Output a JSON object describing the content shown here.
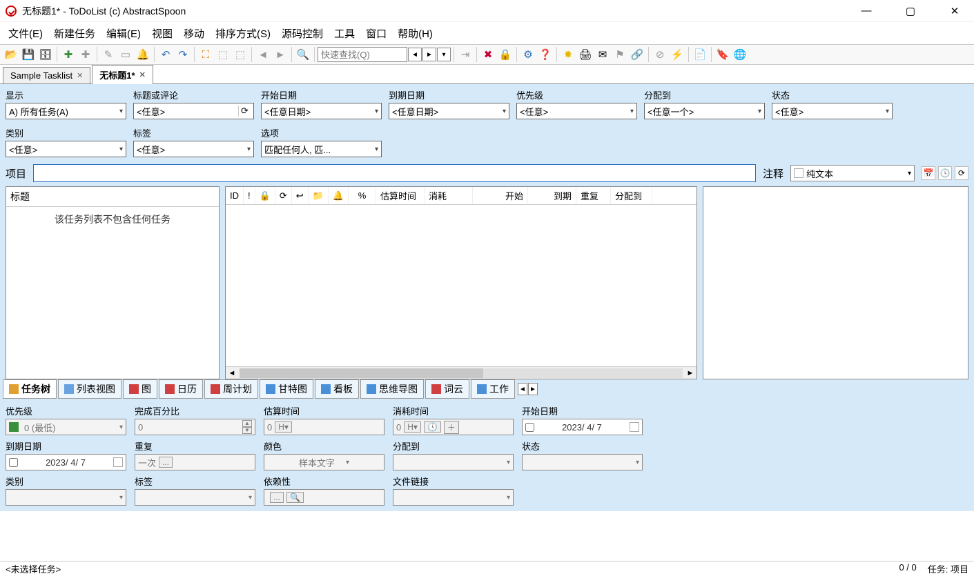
{
  "title": "无标题1* - ToDoList (c) AbstractSpoon",
  "menu": [
    "文件(E)",
    "新建任务",
    "编辑(E)",
    "视图",
    "移动",
    "排序方式(S)",
    "源码控制",
    "工具",
    "窗口",
    "帮助(H)"
  ],
  "search_placeholder": "快速查找(Q)",
  "tabs": [
    {
      "label": "Sample Tasklist",
      "active": false
    },
    {
      "label": "无标题1*",
      "active": true
    }
  ],
  "filters": {
    "display": {
      "label": "显示",
      "value": "A) 所有任务(A)"
    },
    "title": {
      "label": "标题或评论",
      "value": "<任意>"
    },
    "start": {
      "label": "开始日期",
      "value": "<任意日期>"
    },
    "due": {
      "label": "到期日期",
      "value": "<任意日期>"
    },
    "prio": {
      "label": "优先级",
      "value": "<任意>"
    },
    "assign": {
      "label": "分配到",
      "value": "<任意一个>"
    },
    "status": {
      "label": "状态",
      "value": "<任意>"
    },
    "category": {
      "label": "类别",
      "value": "<任意>"
    },
    "tag": {
      "label": "标签",
      "value": "<任意>"
    },
    "option": {
      "label": "选项",
      "value": "匹配任何人, 匹..."
    }
  },
  "project_label": "项目",
  "comment_label": "注释",
  "comment_type": "纯文本",
  "left_header": "标题",
  "left_empty": "该任务列表不包含任何任务",
  "grid_cols": [
    "ID",
    "!",
    "🔒",
    "⟳",
    "↩",
    "📁",
    "🔔",
    "%",
    "估算时间",
    "消耗",
    "开始",
    "到期",
    "重复",
    "分配到"
  ],
  "view_tabs": [
    "任务树",
    "列表视图",
    "图",
    "日历",
    "周计划",
    "甘特图",
    "看板",
    "思维导图",
    "词云",
    "工作"
  ],
  "attrs": {
    "prio": {
      "label": "优先级",
      "value": "0 (最低)"
    },
    "pct": {
      "label": "完成百分比",
      "value": "0"
    },
    "est": {
      "label": "估算时间",
      "value": "0"
    },
    "spent": {
      "label": "消耗时间",
      "value": "0"
    },
    "sdate": {
      "label": "开始日期",
      "value": "2023/ 4/ 7"
    },
    "ddate": {
      "label": "到期日期",
      "value": "2023/ 4/ 7"
    },
    "repeat": {
      "label": "重复",
      "value": "一次"
    },
    "color": {
      "label": "颜色",
      "value": "样本文字"
    },
    "assign": {
      "label": "分配到",
      "value": ""
    },
    "status": {
      "label": "状态",
      "value": ""
    },
    "cat": {
      "label": "类别",
      "value": ""
    },
    "tag": {
      "label": "标签",
      "value": ""
    },
    "dep": {
      "label": "依赖性",
      "value": ""
    },
    "file": {
      "label": "文件链接",
      "value": ""
    }
  },
  "status_left": "<未选择任务>",
  "status_count": "0 / 0",
  "status_right": "任务: 项目"
}
